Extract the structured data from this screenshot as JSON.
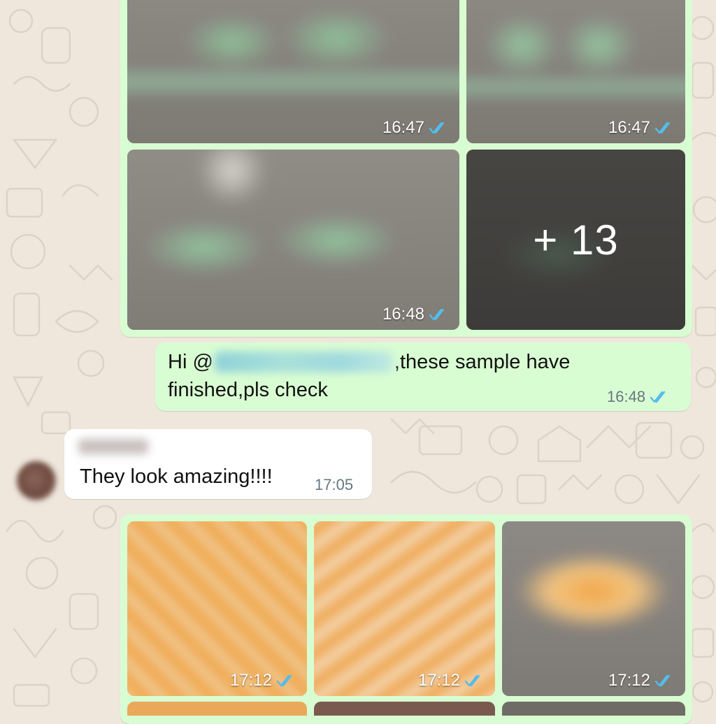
{
  "gallery_top": {
    "tiles": [
      {
        "time": "16:47"
      },
      {
        "time": "16:47"
      },
      {
        "time": "16:48"
      },
      {
        "more_label": "+ 13"
      }
    ]
  },
  "message_out": {
    "greeting": "Hi @",
    "text_after_mention": ",these sample have",
    "text_line2": "finished,pls check",
    "time": "16:48"
  },
  "message_in": {
    "text": "They look amazing!!!!",
    "time": "17:05"
  },
  "gallery_bottom": {
    "tiles": [
      {
        "time": "17:12"
      },
      {
        "time": "17:12"
      },
      {
        "time": "17:12"
      }
    ]
  },
  "colors": {
    "outgoing_bubble": "#d9fdd3",
    "incoming_bubble": "#ffffff",
    "read_ticks": "#53bdeb",
    "wallpaper": "#efe7dc"
  }
}
